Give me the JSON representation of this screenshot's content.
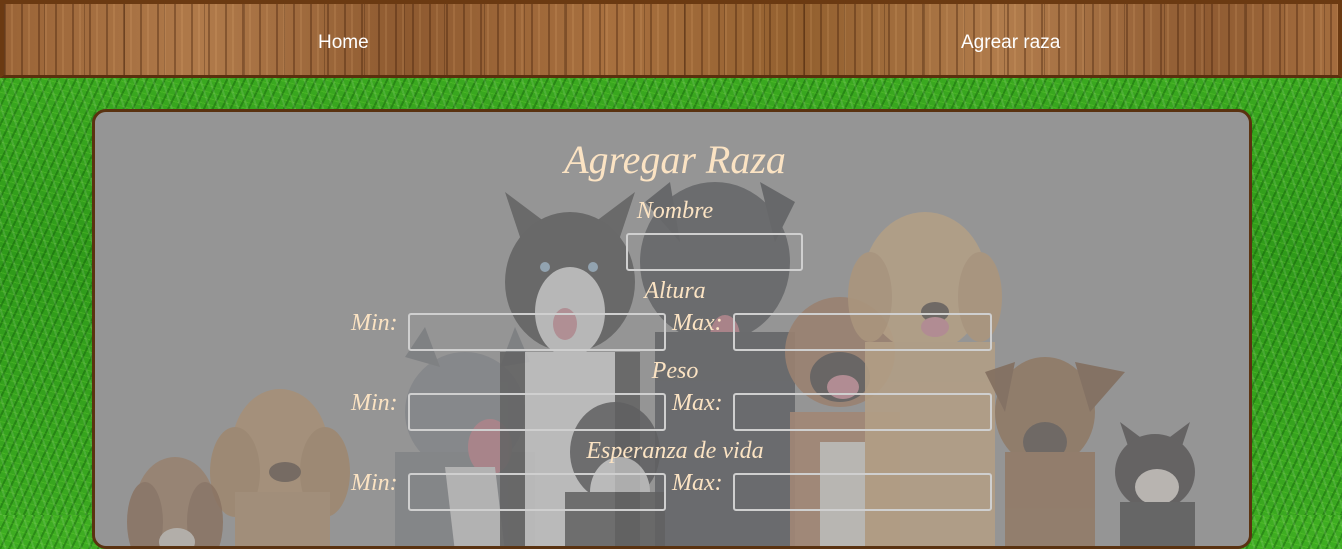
{
  "nav": {
    "home_label": "Home",
    "add_label": "Agrear raza"
  },
  "form": {
    "title": "Agregar Raza",
    "nombre_label": "Nombre",
    "nombre_value": "",
    "altura_label": "Altura",
    "peso_label": "Peso",
    "vida_label": "Esperanza de vida",
    "min_label": "Min:",
    "max_label": "Max:",
    "altura_min": "",
    "altura_max": "",
    "peso_min": "",
    "peso_max": "",
    "vida_min": "",
    "vida_max": ""
  },
  "colors": {
    "label": "#fbe3c3",
    "card_bg": "#959595",
    "wood_border": "#6b3a12"
  }
}
